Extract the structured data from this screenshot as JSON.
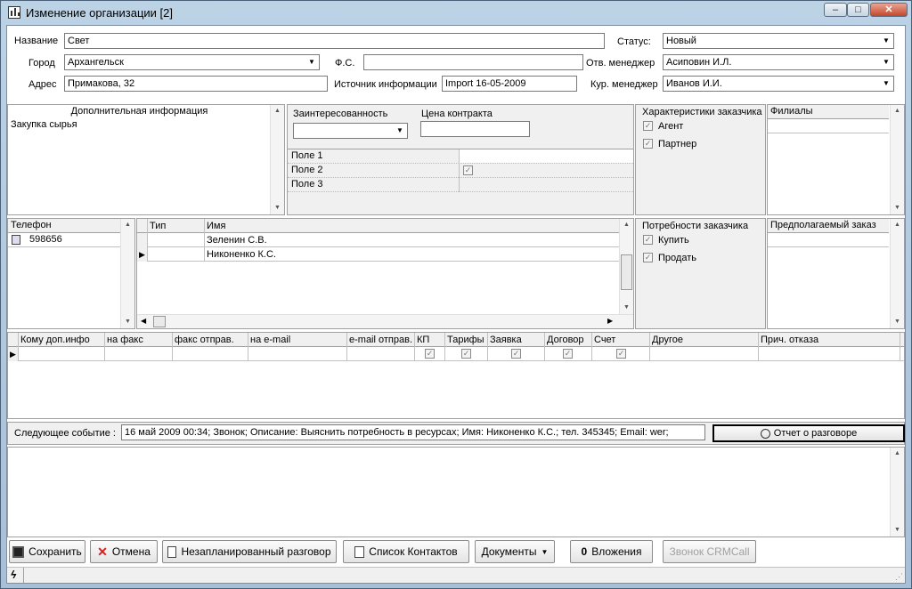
{
  "window": {
    "title": "Изменение организации [2]",
    "min": "–",
    "max": "□",
    "close": "✕"
  },
  "org": {
    "name_label": "Название",
    "name_value": "Свет",
    "city_label": "Город",
    "city_value": "Архангельск",
    "address_label": "Адрес",
    "address_value": "Примакова, 32",
    "fs_label": "Ф.С.",
    "fs_value": "",
    "source_label": "Источник информации",
    "source_value": "Import 16-05-2009",
    "status_label": "Статус:",
    "status_value": "Новый",
    "resp_label": "Отв. менеджер",
    "resp_value": "Асиповин И.Л.",
    "cur_label": "Кур. менеджер",
    "cur_value": "Иванов И.И."
  },
  "extra": {
    "title": "Дополнительная информация",
    "text": "Закупка сырья"
  },
  "interest": {
    "label": "Заинтересованность",
    "price_label": "Цена контракта",
    "fields": [
      "Поле 1",
      "Поле 2",
      "Поле 3"
    ]
  },
  "traits": {
    "title": "Характеристики заказчика",
    "agent": "Агент",
    "partner": "Партнер"
  },
  "branches": {
    "title": "Филиалы"
  },
  "phones": {
    "title": "Телефон",
    "items": [
      "598656"
    ]
  },
  "contacts": {
    "col_type": "Тип",
    "col_name": "Имя",
    "rows": [
      "Зеленин С.В.",
      "Никоненко К.С."
    ]
  },
  "needs": {
    "title": "Потребности заказчика",
    "buy": "Купить",
    "sell": "Продать"
  },
  "order": {
    "title": "Предполагаемый заказ"
  },
  "dist": {
    "cols": [
      "Кому доп.инфо",
      "на факс",
      "факс отправ.",
      "на e-mail",
      "e-mail отправ.",
      "КП",
      "Тарифы",
      "Заявка",
      "Договор",
      "Счет",
      "Другое",
      "Прич. отказа"
    ]
  },
  "event": {
    "label": "Следующее событие :",
    "text": "16 май 2009 00:34; Звонок; Описание: Выяснить потребность в ресурсах; Имя: Никоненко К.С.; тел. 345345; Email: wer;",
    "report_btn": "Отчет о разговоре"
  },
  "toolbar": {
    "save": "Сохранить",
    "cancel": "Отмена",
    "unplanned": "Незапланированный разговор",
    "contacts": "Список Контактов",
    "docs": "Документы",
    "attach": "Вложения",
    "call": "Звонок CRMCall"
  },
  "colors": {
    "accent": "#c4452b",
    "frame": "#a7c0d8"
  }
}
